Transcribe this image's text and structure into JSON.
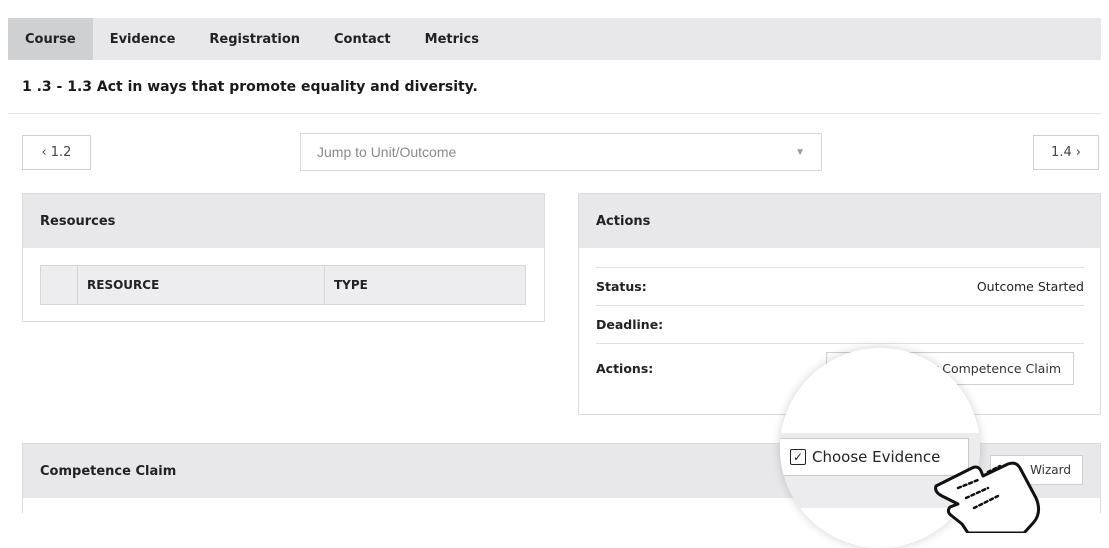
{
  "tabs": [
    {
      "label": "Course",
      "active": true
    },
    {
      "label": "Evidence",
      "active": false
    },
    {
      "label": "Registration",
      "active": false
    },
    {
      "label": "Contact",
      "active": false
    },
    {
      "label": "Metrics",
      "active": false
    }
  ],
  "page_title": "1 .3 - 1.3 Act in ways that promote equality and diversity.",
  "nav": {
    "prev_label": "1.2",
    "next_label": "1.4",
    "jump_placeholder": "Jump to Unit/Outcome"
  },
  "resources": {
    "title": "Resources",
    "columns": [
      "RESOURCE",
      "TYPE"
    ]
  },
  "actions_panel": {
    "title": "Actions",
    "rows": [
      {
        "label": "Status:",
        "value": "Outcome Started"
      },
      {
        "label": "Deadline:",
        "value": ""
      },
      {
        "label": "Actions:",
        "value": ""
      }
    ],
    "button_label": "r Competence Claim"
  },
  "competence": {
    "title": "Competence Claim",
    "wizard_label": "Wizard"
  },
  "magnifier": {
    "choose_label": "Choose Evidence"
  },
  "colors": {
    "tabbar_bg": "#e8e8ea",
    "active_tab_bg": "#cfd0d2",
    "panel_header_bg": "#e8e8ea"
  }
}
